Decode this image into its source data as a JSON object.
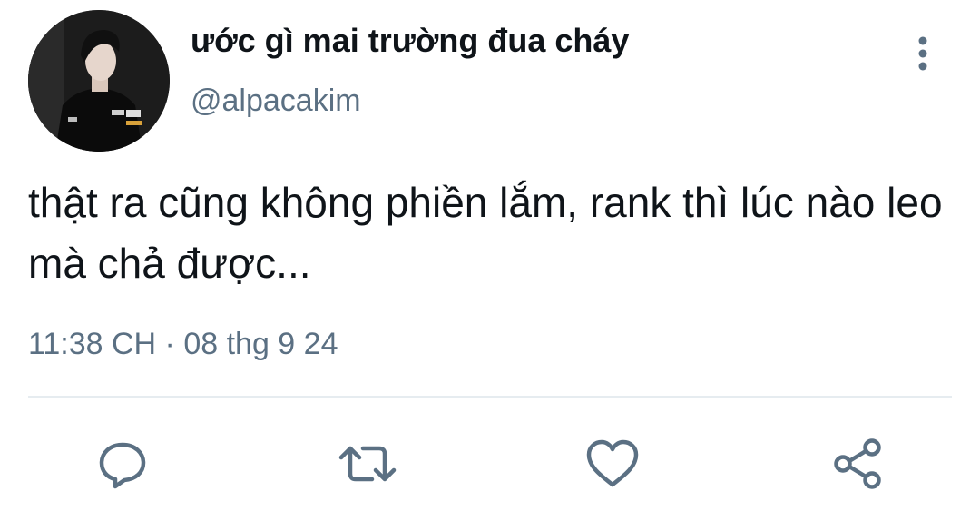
{
  "tweet": {
    "display_name": "ước gì mai trường đua cháy",
    "handle": "@alpacakim",
    "text": "thật ra cũng không phiền lắm, rank thì lúc nào leo mà chả được...",
    "timestamp": "11:38 CH · 08 thg 9 24"
  },
  "actions": {
    "reply_icon": "comment-bubble-icon",
    "retweet_icon": "retweet-arrows-icon",
    "like_icon": "heart-outline-icon",
    "share_icon": "share-nodes-icon",
    "more_icon": "vertical-dots-icon"
  },
  "colors": {
    "text_primary": "#0f1419",
    "text_secondary": "#5b7083",
    "divider": "#e6ecf0",
    "icon": "#5b7083"
  }
}
